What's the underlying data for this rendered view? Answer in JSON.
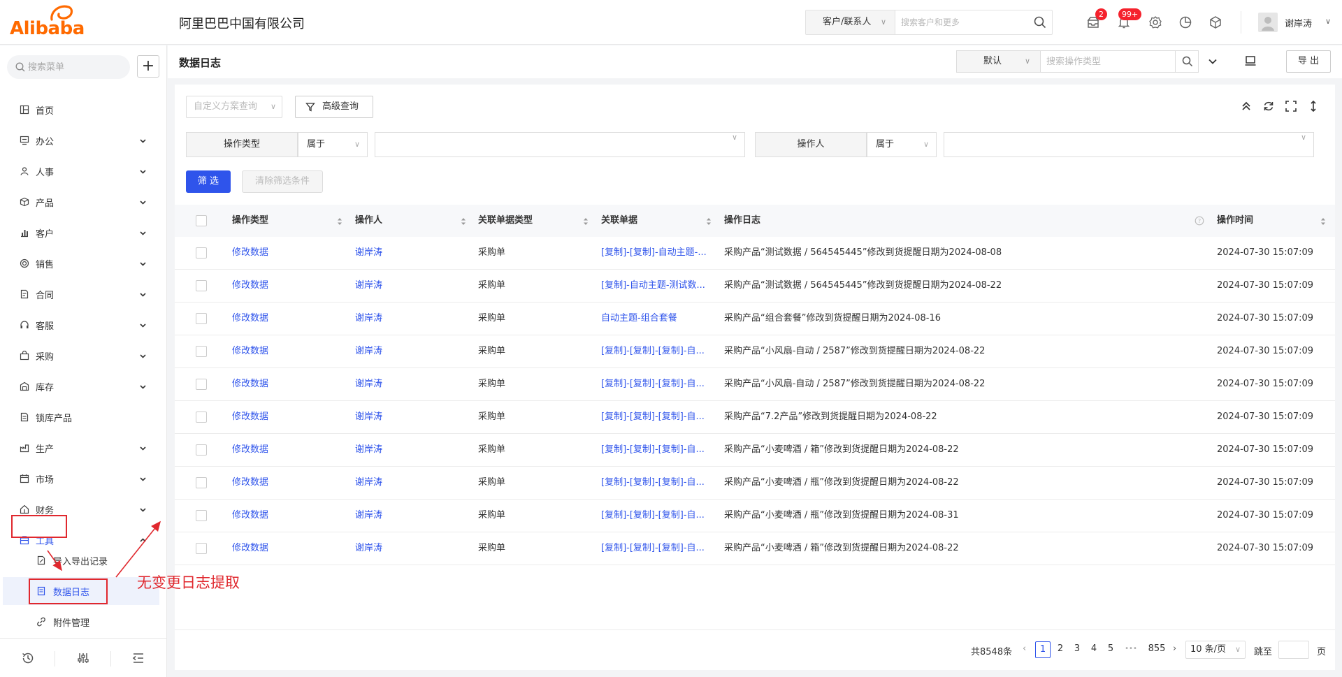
{
  "brand": {
    "logo_text": "Alibaba",
    "logo_color": "#ff6a00"
  },
  "header": {
    "company": "阿里巴巴中国有限公司",
    "search_type": "客户/联系人",
    "search_placeholder": "搜索客户和更多",
    "badge_messages": "2",
    "badge_notifications": "99+",
    "user_name": "谢岸涛"
  },
  "sidebar": {
    "search_placeholder": "搜索菜单",
    "items": [
      {
        "label": "首页",
        "icon": "layout-icon",
        "expandable": false
      },
      {
        "label": "办公",
        "icon": "office-icon",
        "expandable": true
      },
      {
        "label": "人事",
        "icon": "people-icon",
        "expandable": true
      },
      {
        "label": "产品",
        "icon": "box-icon",
        "expandable": true
      },
      {
        "label": "客户",
        "icon": "chart-bar-icon",
        "expandable": true
      },
      {
        "label": "销售",
        "icon": "target-icon",
        "expandable": true
      },
      {
        "label": "合同",
        "icon": "contract-icon",
        "expandable": true
      },
      {
        "label": "客服",
        "icon": "headset-icon",
        "expandable": true
      },
      {
        "label": "采购",
        "icon": "bag-icon",
        "expandable": true
      },
      {
        "label": "库存",
        "icon": "warehouse-icon",
        "expandable": true
      },
      {
        "label": "锁库产品",
        "icon": "lock-doc-icon",
        "expandable": false
      },
      {
        "label": "生产",
        "icon": "production-icon",
        "expandable": true
      },
      {
        "label": "市场",
        "icon": "calendar-icon",
        "expandable": true
      },
      {
        "label": "财务",
        "icon": "home-finance-icon",
        "expandable": true
      },
      {
        "label": "工具",
        "icon": "toolbox-icon",
        "expandable": true,
        "expanded": true
      }
    ],
    "sub_items": [
      {
        "label": "导入导出记录",
        "icon": "edit-doc-icon",
        "active": false
      },
      {
        "label": "数据日志",
        "icon": "log-doc-icon",
        "active": true
      },
      {
        "label": "附件管理",
        "icon": "link-icon",
        "active": false
      }
    ]
  },
  "page": {
    "title": "数据日志",
    "view_select": "默认",
    "search_placeholder": "搜索操作类型",
    "export_label": "导 出"
  },
  "toolbar": {
    "custom_scheme_placeholder": "自定义方案查询",
    "advanced_query": "高级查询",
    "filter_btn": "筛 选",
    "clear_btn": "清除筛选条件"
  },
  "filters": [
    {
      "label": "操作类型",
      "operator": "属于",
      "value": ""
    },
    {
      "label": "操作人",
      "operator": "属于",
      "value": ""
    }
  ],
  "table": {
    "columns": [
      "操作类型",
      "操作人",
      "关联单据类型",
      "关联单据",
      "操作日志",
      "操作时间"
    ],
    "rows": [
      {
        "type": "修改数据",
        "operator": "谢岸涛",
        "doc_type": "采购单",
        "doc": "[复制]-[复制]-自动主题-...",
        "log": "采购产品“测试数据 / 564545445”修改到货提醒日期为2024-08-08",
        "time": "2024-07-30 15:07:09"
      },
      {
        "type": "修改数据",
        "operator": "谢岸涛",
        "doc_type": "采购单",
        "doc": "[复制]-自动主题-测试数...",
        "log": "采购产品“测试数据 / 564545445”修改到货提醒日期为2024-08-22",
        "time": "2024-07-30 15:07:09"
      },
      {
        "type": "修改数据",
        "operator": "谢岸涛",
        "doc_type": "采购单",
        "doc": "自动主题-组合套餐",
        "log": "采购产品“组合套餐”修改到货提醒日期为2024-08-16",
        "time": "2024-07-30 15:07:09"
      },
      {
        "type": "修改数据",
        "operator": "谢岸涛",
        "doc_type": "采购单",
        "doc": "[复制]-[复制]-[复制]-自...",
        "log": "采购产品“小风扇-自动 / 2587”修改到货提醒日期为2024-08-22",
        "time": "2024-07-30 15:07:09"
      },
      {
        "type": "修改数据",
        "operator": "谢岸涛",
        "doc_type": "采购单",
        "doc": "[复制]-[复制]-[复制]-自...",
        "log": "采购产品“小风扇-自动 / 2587”修改到货提醒日期为2024-08-22",
        "time": "2024-07-30 15:07:09"
      },
      {
        "type": "修改数据",
        "operator": "谢岸涛",
        "doc_type": "采购单",
        "doc": "[复制]-[复制]-[复制]-自...",
        "log": "采购产品“7.2产品”修改到货提醒日期为2024-08-22",
        "time": "2024-07-30 15:07:09"
      },
      {
        "type": "修改数据",
        "operator": "谢岸涛",
        "doc_type": "采购单",
        "doc": "[复制]-[复制]-[复制]-自...",
        "log": "采购产品“小麦啤酒 / 箱”修改到货提醒日期为2024-08-22",
        "time": "2024-07-30 15:07:09"
      },
      {
        "type": "修改数据",
        "operator": "谢岸涛",
        "doc_type": "采购单",
        "doc": "[复制]-[复制]-[复制]-自...",
        "log": "采购产品“小麦啤酒 / 瓶”修改到货提醒日期为2024-08-22",
        "time": "2024-07-30 15:07:09"
      },
      {
        "type": "修改数据",
        "operator": "谢岸涛",
        "doc_type": "采购单",
        "doc": "[复制]-[复制]-[复制]-自...",
        "log": "采购产品“小麦啤酒 / 瓶”修改到货提醒日期为2024-08-31",
        "time": "2024-07-30 15:07:09"
      },
      {
        "type": "修改数据",
        "operator": "谢岸涛",
        "doc_type": "采购单",
        "doc": "[复制]-[复制]-[复制]-自...",
        "log": "采购产品“小麦啤酒 / 箱”修改到货提醒日期为2024-08-22",
        "time": "2024-07-30 15:07:09"
      }
    ]
  },
  "pagination": {
    "total": "共8548条",
    "pages": [
      "1",
      "2",
      "3",
      "4",
      "5"
    ],
    "ellipsis": "•••",
    "last_page": "855",
    "current": "1",
    "page_size": "10 条/页",
    "jump_label": "跳至",
    "page_suffix": "页"
  },
  "annotation": {
    "text": "无变更日志提取",
    "color": "#e0282e"
  },
  "colors": {
    "primary": "#2f54eb",
    "danger": "#f5222d"
  }
}
